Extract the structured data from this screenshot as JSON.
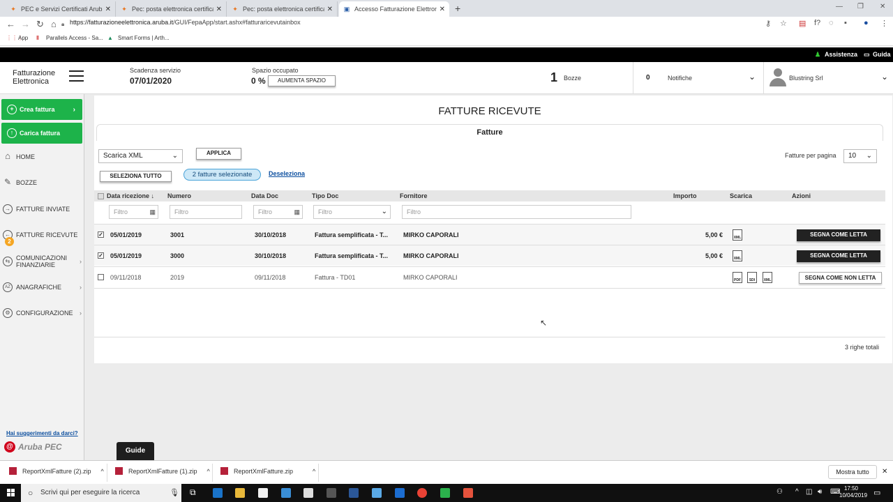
{
  "browser": {
    "tabs": [
      {
        "title": "PEC e Servizi Certificati Aruba: Fa"
      },
      {
        "title": "Pec: posta elettronica certificata"
      },
      {
        "title": "Pec: posta elettronica certificata"
      },
      {
        "title": "Accesso Fatturazione Elettronica"
      }
    ],
    "url_host": "https://fatturazioneelettronica.aruba.it",
    "url_path": "/GUI/FepaApp/start.ashx#fatturaricevutainbox",
    "bookmarks": [
      "App",
      "Parallels Access - Sa...",
      "Smart Forms | Arth..."
    ]
  },
  "topbar": {
    "assistenza": "Assistenza",
    "guida": "Guida"
  },
  "header": {
    "logo_line1": "Fatturazione",
    "logo_line2": "Elettronica",
    "scadenza_label": "Scadenza servizio",
    "scadenza_value": "07/01/2020",
    "spazio_label": "Spazio occupato",
    "spazio_value": "0 %",
    "aumenta_label": "AUMENTA SPAZIO",
    "bozze_count": "1",
    "bozze_label": "Bozze",
    "notifiche_count": "0",
    "notifiche_label": "Notifiche",
    "user_name": "Blustring Srl"
  },
  "sidebar": {
    "crea": "Crea fattura",
    "carica": "Carica fattura",
    "items": [
      {
        "label": "HOME"
      },
      {
        "label": "BOZZE"
      },
      {
        "label": "FATTURE INVIATE"
      },
      {
        "label": "FATTURE RICEVUTE",
        "badge": "2"
      },
      {
        "label": "COMUNICAZIONI FINANZIARIE"
      },
      {
        "label": "ANAGRAFICHE"
      },
      {
        "label": "CONFIGURAZIONE"
      }
    ],
    "suggerimenti": "Hai suggerimenti da darci?",
    "brand": "Aruba PEC"
  },
  "main": {
    "title": "FATTURE RICEVUTE",
    "tab": "Fatture",
    "action_select": "Scarica XML",
    "applica": "APPLICA",
    "per_pagina_label": "Fatture per pagina",
    "per_pagina_value": "10",
    "seleziona_tutto": "SELEZIONA TUTTO",
    "selezionate": "2 fatture selezionate",
    "deseleziona": "Deseleziona",
    "columns": [
      "Data ricezione ↓",
      "Numero",
      "Data Doc",
      "Tipo Doc",
      "Fornitore",
      "Importo",
      "Scarica",
      "Azioni"
    ],
    "filter_placeholder": "Filtro",
    "rows": [
      {
        "data": "05/01/2019",
        "numero": "3001",
        "data_doc": "30/10/2018",
        "tipo": "Fattura semplificata - T...",
        "fornitore": "MIRKO CAPORALI",
        "importo": "5,00 €",
        "azione": "SEGNA COME LETTA"
      },
      {
        "data": "05/01/2019",
        "numero": "3000",
        "data_doc": "30/10/2018",
        "tipo": "Fattura semplificata - T...",
        "fornitore": "MIRKO CAPORALI",
        "importo": "5,00 €",
        "azione": "SEGNA COME LETTA"
      },
      {
        "data": "09/11/2018",
        "numero": "2019",
        "data_doc": "09/11/2018",
        "tipo": "Fattura - TD01",
        "fornitore": "MIRKO CAPORALI",
        "importo": "",
        "azione": "SEGNA COME NON LETTA"
      }
    ],
    "download_labels": [
      "XML",
      "PDF",
      "SDI",
      "XML"
    ],
    "totale": "3 righe totali",
    "guide": "Guide"
  },
  "downloads": {
    "files": [
      "ReportXmlFatture (2).zip",
      "ReportXmlFatture (1).zip",
      "ReportXmlFatture.zip"
    ],
    "mostra_tutto": "Mostra tutto"
  },
  "taskbar": {
    "search_placeholder": "Scrivi qui per eseguire la ricerca",
    "time": "17:50",
    "date": "10/04/2019"
  }
}
